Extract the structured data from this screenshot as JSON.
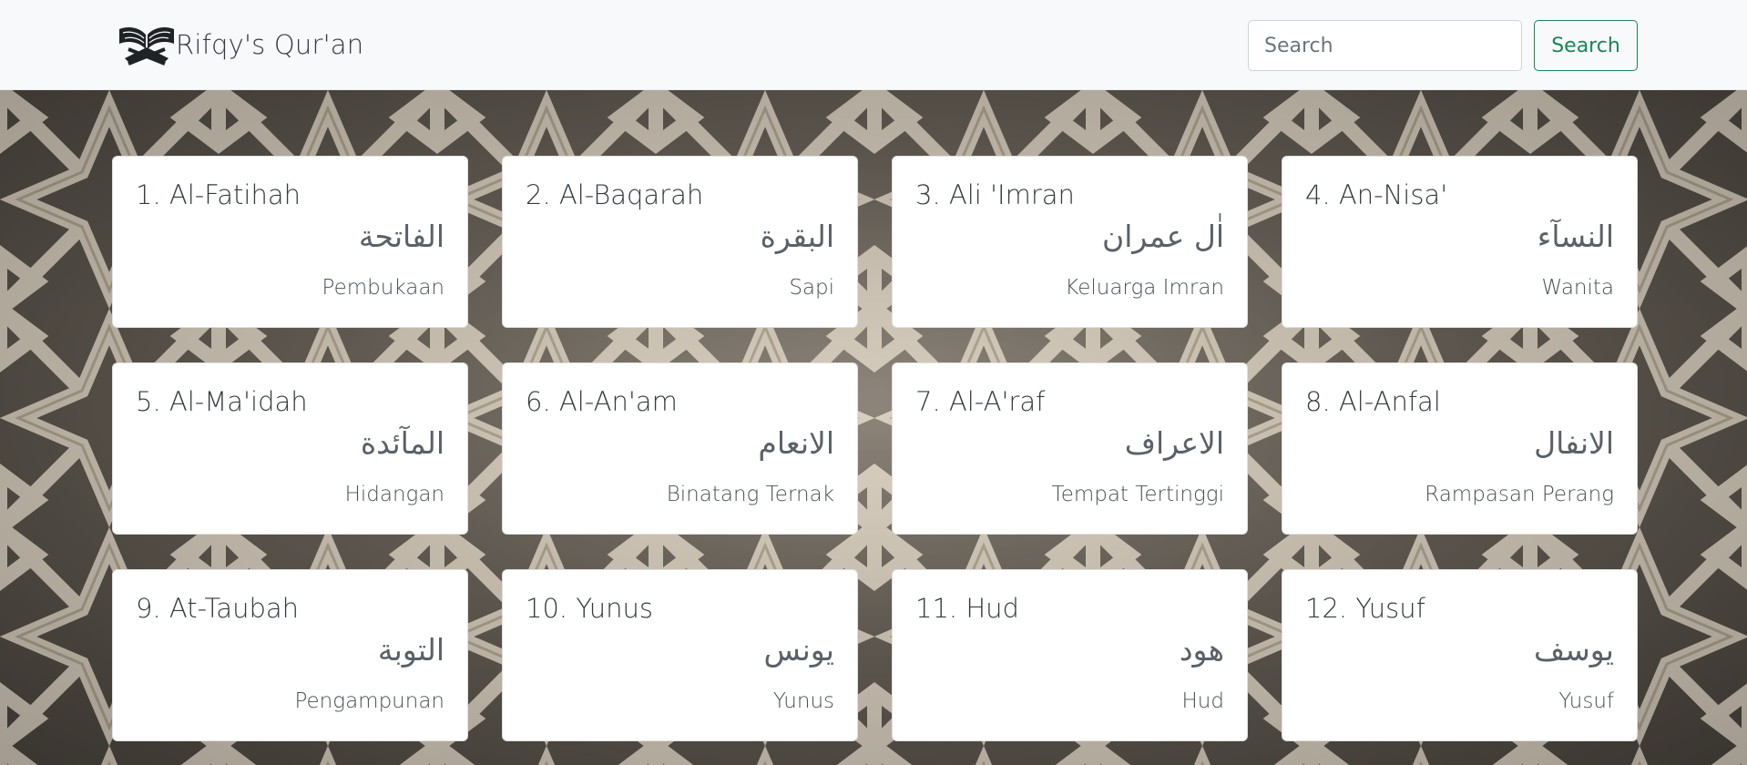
{
  "navbar": {
    "brand_icon": "quran-book-icon",
    "brand_text": "Rifqy's Qur'an",
    "search_placeholder": "Search",
    "search_button": "Search",
    "search_button_color": "#198754"
  },
  "surahs": [
    {
      "title": "1. Al-Fatihah",
      "arabic": "الفاتحة",
      "meaning": "Pembukaan"
    },
    {
      "title": "2. Al-Baqarah",
      "arabic": "البقرة",
      "meaning": "Sapi"
    },
    {
      "title": "3. Ali 'Imran",
      "arabic": "اٰل عمران",
      "meaning": "Keluarga Imran"
    },
    {
      "title": "4. An-Nisa'",
      "arabic": "النسآء",
      "meaning": "Wanita"
    },
    {
      "title": "5. Al-Ma'idah",
      "arabic": "المآئدة",
      "meaning": "Hidangan"
    },
    {
      "title": "6. Al-An'am",
      "arabic": "الانعام",
      "meaning": "Binatang Ternak"
    },
    {
      "title": "7. Al-A'raf",
      "arabic": "الاعراف",
      "meaning": "Tempat Tertinggi"
    },
    {
      "title": "8. Al-Anfal",
      "arabic": "الانفال",
      "meaning": "Rampasan Perang"
    },
    {
      "title": "9. At-Taubah",
      "arabic": "التوبة",
      "meaning": "Pengampunan"
    },
    {
      "title": "10. Yunus",
      "arabic": "يونس",
      "meaning": "Yunus"
    },
    {
      "title": "11. Hud",
      "arabic": "هود",
      "meaning": "Hud"
    },
    {
      "title": "12. Yusuf",
      "arabic": "يوسف",
      "meaning": "Yusuf"
    }
  ]
}
